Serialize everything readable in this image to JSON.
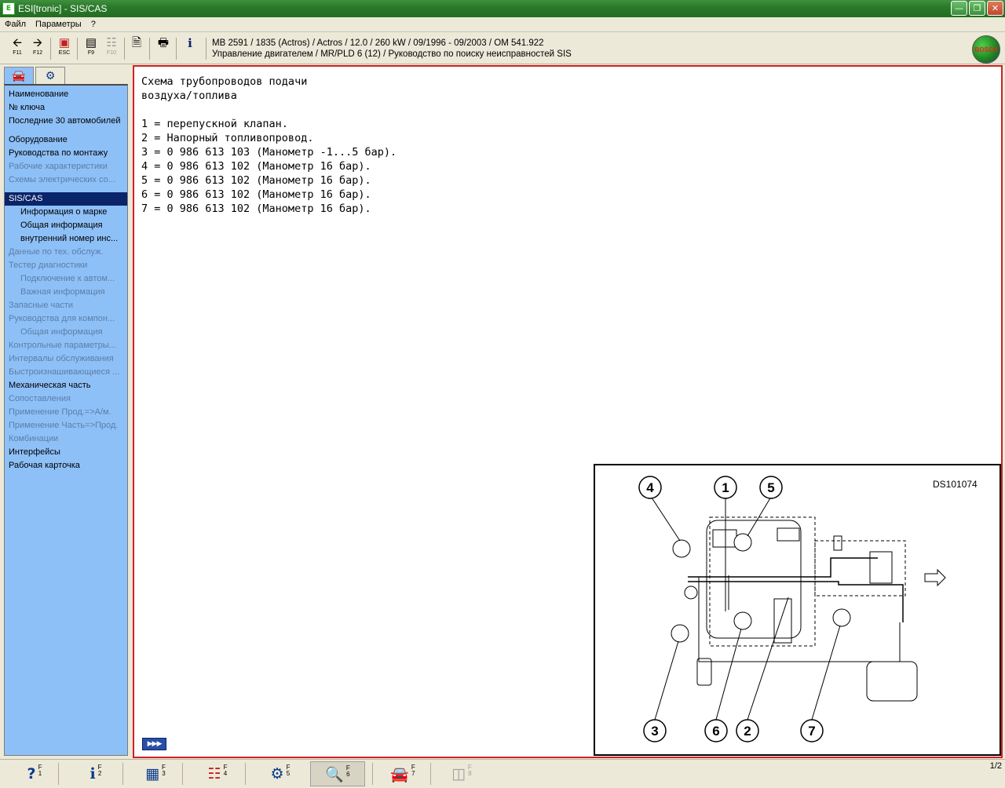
{
  "window": {
    "title": "ESI[tronic] - SIS/CAS"
  },
  "menu": [
    "Файл",
    "Параметры",
    "?"
  ],
  "toolbar": {
    "back": "F11",
    "forward": "F12",
    "esc": "ESC",
    "f9": "F9",
    "f10": "F10"
  },
  "vehicle": {
    "line1": "MB 2591 / 1835 (Actros) / Actros / 12.0 / 260 kW / 09/1996 - 09/2003 / OM 541.922",
    "line2": "Управление двигателем / MR/PLD 6 (12) / Руководство по поиску неисправностей SIS"
  },
  "brand": "BOSCH",
  "nav": {
    "items": [
      {
        "label": "Наименование",
        "state": "normal",
        "level": 0
      },
      {
        "label": "№ ключа",
        "state": "normal",
        "level": 0
      },
      {
        "label": "Последние 30 автомобилей",
        "state": "normal",
        "level": 0
      },
      {
        "label": "Оборудование",
        "state": "normal",
        "level": 0
      },
      {
        "label": "Руководства по монтажу",
        "state": "normal",
        "level": 0
      },
      {
        "label": "Рабочие характеристики",
        "state": "disabled",
        "level": 0
      },
      {
        "label": "Схемы электрических со...",
        "state": "disabled",
        "level": 0
      },
      {
        "label": "SIS/CAS",
        "state": "selected",
        "level": 0
      },
      {
        "label": "Информация о марке",
        "state": "normal",
        "level": 1
      },
      {
        "label": "Общая информация",
        "state": "normal",
        "level": 1
      },
      {
        "label": "внутренний номер инс...",
        "state": "normal",
        "level": 1
      },
      {
        "label": "Данные по тех. обслуж.",
        "state": "disabled",
        "level": 0
      },
      {
        "label": "Тестер диагностики",
        "state": "disabled",
        "level": 0
      },
      {
        "label": "Подключение к автом...",
        "state": "disabled",
        "level": 1
      },
      {
        "label": "Важная информация",
        "state": "disabled",
        "level": 1
      },
      {
        "label": "Запасные части",
        "state": "disabled",
        "level": 0
      },
      {
        "label": "Руководства для компон...",
        "state": "disabled",
        "level": 0
      },
      {
        "label": "Общая информация",
        "state": "disabled",
        "level": 1
      },
      {
        "label": "Контрольные параметры...",
        "state": "disabled",
        "level": 0
      },
      {
        "label": "Интервалы обслуживания",
        "state": "disabled",
        "level": 0
      },
      {
        "label": "Быстроизнашивающиеся ...",
        "state": "disabled",
        "level": 0
      },
      {
        "label": "Механическая часть",
        "state": "normal",
        "level": 0
      },
      {
        "label": "Сопоставления",
        "state": "disabled",
        "level": 0
      },
      {
        "label": "Применение Прод.=>А/м.",
        "state": "disabled",
        "level": 0
      },
      {
        "label": "Применение Часть=>Прод.",
        "state": "disabled",
        "level": 0
      },
      {
        "label": "Комбинации",
        "state": "disabled",
        "level": 0
      },
      {
        "label": "Интерфейсы",
        "state": "normal",
        "level": 0
      },
      {
        "label": "Рабочая карточка",
        "state": "normal",
        "level": 0
      }
    ]
  },
  "document": {
    "title_line1": "Схема трубопроводов подачи",
    "title_line2": "воздуха/топлива",
    "legend": [
      "1 = перепускной клапан.",
      "2 = Напорный топливопровод.",
      "3 = 0 986 613 103 (Манометр -1...5 бар).",
      "4 = 0 986 613 102 (Манометр 16 бар).",
      "5 = 0 986 613 102 (Манометр 16 бар).",
      "6 = 0 986 613 102 (Манометр 16 бар).",
      "7 = 0 986 613 102 (Манометр 16 бар)."
    ]
  },
  "diagram": {
    "code": "DS101074",
    "callouts": [
      "1",
      "2",
      "3",
      "4",
      "5",
      "6",
      "7"
    ]
  },
  "fkeys": [
    {
      "label": "F\n1"
    },
    {
      "label": "F\n2"
    },
    {
      "label": "F\n3"
    },
    {
      "label": "F\n4"
    },
    {
      "label": "F\n5"
    },
    {
      "label": "F\n6"
    },
    {
      "label": "F\n7"
    },
    {
      "label": "F\n8"
    }
  ],
  "page": "1/2"
}
